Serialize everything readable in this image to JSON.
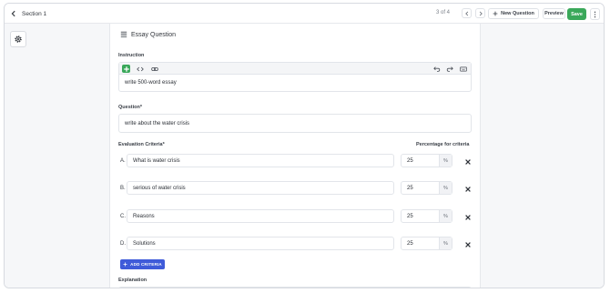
{
  "header": {
    "back_label": "Section 1",
    "pager": "3 of 4",
    "new_question_label": "New Question",
    "preview_label": "Preview",
    "save_label": "Save"
  },
  "question": {
    "type_label": "Essay Question",
    "instruction_label": "Instruction",
    "instruction_text": "write 500-word essay",
    "question_label": "Question*",
    "question_text": "write about the water crisis",
    "criteria_label": "Evaluation Criteria*",
    "percentage_label": "Percentage for criteria",
    "criteria": [
      {
        "letter": "A.",
        "text": "What is water crisis",
        "percent": "25"
      },
      {
        "letter": "B.",
        "text": "serious of water crisis",
        "percent": "25"
      },
      {
        "letter": "C.",
        "text": "Reasons",
        "percent": "25"
      },
      {
        "letter": "D.",
        "text": "Solutions",
        "percent": "25"
      }
    ],
    "percent_sign": "%",
    "add_criteria_label": "ADD CRITERIA",
    "explanation_label": "Explanation"
  },
  "colors": {
    "save": "#3aa85a",
    "add_criteria": "#3f5bd9",
    "editor_add": "#3aa85a"
  }
}
